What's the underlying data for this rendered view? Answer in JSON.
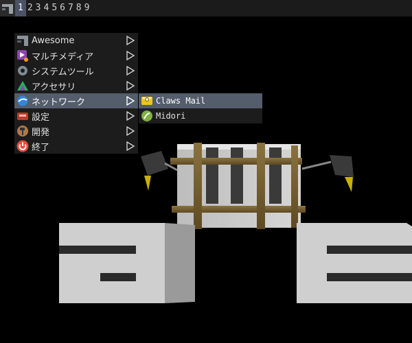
{
  "topbar": {
    "tags": [
      "1",
      "2",
      "3",
      "4",
      "5",
      "6",
      "7",
      "8",
      "9"
    ],
    "active_tag": "1"
  },
  "menu": {
    "items": [
      {
        "label": "Awesome",
        "icon": "awesome-icon"
      },
      {
        "label": "マルチメディア",
        "icon": "multimedia-icon"
      },
      {
        "label": "システムツール",
        "icon": "gear-icon"
      },
      {
        "label": "アクセサリ",
        "icon": "accessories-icon"
      },
      {
        "label": "ネットワーク",
        "icon": "network-icon",
        "highlighted": true
      },
      {
        "label": "設定",
        "icon": "settings-icon"
      },
      {
        "label": "開発",
        "icon": "hammer-icon"
      },
      {
        "label": "終了",
        "icon": "power-icon"
      }
    ]
  },
  "submenu": {
    "items": [
      {
        "label": "Claws Mail",
        "icon": "mail-icon",
        "highlighted": true
      },
      {
        "label": "Midori",
        "icon": "midori-icon"
      }
    ]
  },
  "colors": {
    "bar": "#1b1b1b",
    "menu_bg": "#1c1c1c",
    "highlight": "#535d6c",
    "tag_active": "#4c5366"
  }
}
